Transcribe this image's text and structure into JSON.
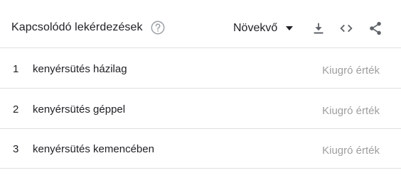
{
  "header": {
    "title": "Kapcsolódó lekérdezések",
    "help_icon": "help-circle-icon",
    "sort": {
      "selected": "Növekvő",
      "caret_icon": "caret-down-icon"
    },
    "tools": [
      {
        "name": "download-icon"
      },
      {
        "name": "embed-code-icon"
      },
      {
        "name": "share-icon"
      }
    ]
  },
  "rows": [
    {
      "rank": "1",
      "term": "kenyérsütés házilag",
      "value": "Kiugró érték"
    },
    {
      "rank": "2",
      "term": "kenyérsütés géppel",
      "value": "Kiugró érték"
    },
    {
      "rank": "3",
      "term": "kenyérsütés kemencében",
      "value": "Kiugró érték"
    }
  ],
  "colors": {
    "text": "#202124",
    "muted": "#9e9e9e",
    "icon": "#5f6368",
    "divider": "#e0e0e0"
  }
}
